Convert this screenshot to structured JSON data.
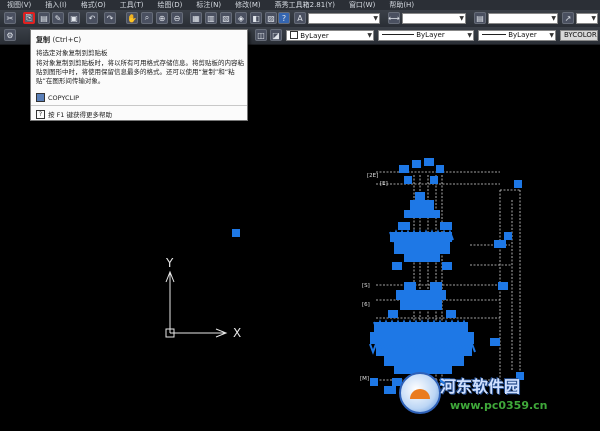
{
  "menu": [
    "视图(V)",
    "插入(I)",
    "格式(O)",
    "工具(T)",
    "绘图(D)",
    "标注(N)",
    "修改(M)",
    "燕秀工具箱2.81(Y)",
    "窗口(W)",
    "帮助(H)"
  ],
  "toolbar": {
    "icons_row1": [
      "cut-icon",
      "copy-icon",
      "paste-icon",
      "match-properties-icon",
      "undo-icon",
      "redo-icon",
      "pan-icon",
      "zoom-realtime-icon",
      "zoom-window-icon",
      "zoom-previous-icon",
      "properties-icon",
      "design-center-icon",
      "tool-palettes-icon",
      "sheet-set-icon",
      "markup-icon",
      "calculator-icon",
      "help-icon"
    ],
    "textstyle_icon": "A"
  },
  "layer_combos": {
    "linetype1": "ByLayer",
    "linetype2": "ByLayer",
    "lineweight": "ByLayer",
    "color": "BYCOLOR"
  },
  "tooltip": {
    "title": "复制",
    "shortcut": "(Ctrl+C)",
    "subtitle": "将选定对象复制到剪贴板",
    "description": "将对象复制到剪贴板时，将以所有可用格式存储信息。将剪贴板的内容粘贴到图形中时，将使用保留信息最多的格式。还可以使用“复制”和“粘贴”在图形间传输对象。",
    "command": "COPYCLIP",
    "help": "按 F1 键获得更多帮助"
  },
  "ucs": {
    "x_label": "X",
    "y_label": "Y"
  },
  "drawing_labels": [
    "[2E]",
    "[E]",
    "[S]",
    "[6]",
    "[M]"
  ],
  "watermark": {
    "site": "河东软件园",
    "url": "www.pc0359.cn"
  },
  "colors": {
    "grip": "#1e78e6",
    "canvas": "#000000",
    "highlight": "#e02020"
  }
}
